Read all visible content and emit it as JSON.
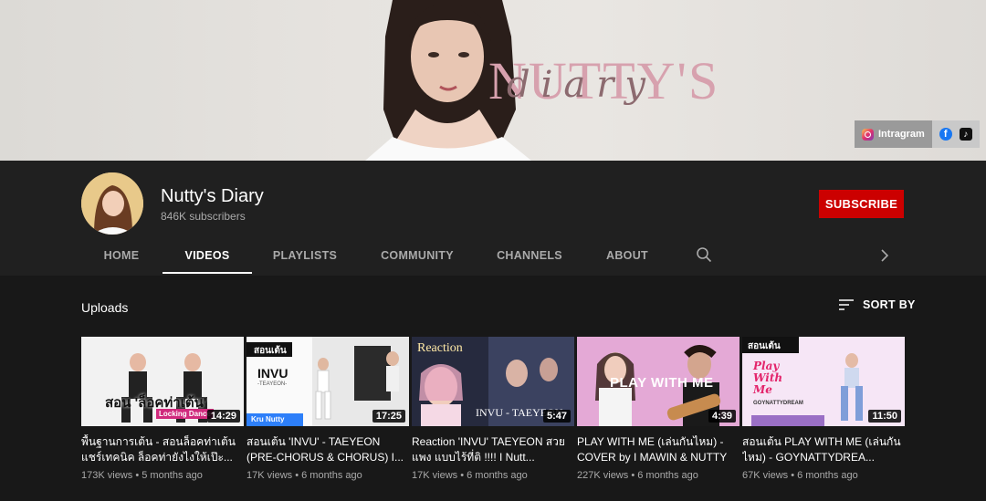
{
  "banner": {
    "logo_main": "NUTTY'S",
    "logo_script": "diary",
    "links": {
      "instagram_label": "Intragram",
      "facebook_glyph": "f",
      "tiktok_glyph": "♪"
    }
  },
  "channel": {
    "name": "Nutty's Diary",
    "subscribers": "846K subscribers",
    "subscribe_label": "SUBSCRIBE"
  },
  "tabs": [
    {
      "label": "HOME"
    },
    {
      "label": "VIDEOS"
    },
    {
      "label": "PLAYLISTS"
    },
    {
      "label": "COMMUNITY"
    },
    {
      "label": "CHANNELS"
    },
    {
      "label": "ABOUT"
    }
  ],
  "uploads": {
    "title": "Uploads",
    "sort_label": "SORT BY"
  },
  "videos": [
    {
      "title": "พื้นฐานการเต้น - สอนล็อคท่าเต้น แชร์เทคนิค ล็อคท่ายังไงให้เป๊ะ...",
      "views": "173K views",
      "age": "5 months ago",
      "duration": "14:29",
      "thumb_text_1": "สอน 'ล็อคท่าเต้น'",
      "thumb_text_2": "Locking Dance"
    },
    {
      "title": "สอนเต้น 'INVU' - TAEYEON (PRE-CHORUS & CHORUS) I...",
      "views": "17K views",
      "age": "6 months ago",
      "duration": "17:25",
      "thumb_text_1": "สอนเต้น",
      "thumb_text_2": "INVU",
      "thumb_text_3": "-TEAYEON-",
      "thumb_text_4": "Kru Nutty"
    },
    {
      "title": "Reaction 'INVU' TAEYEON สวย แพง แบบไร้ที่ติ !!!! I Nutt...",
      "views": "17K views",
      "age": "6 months ago",
      "duration": "5:47",
      "thumb_text_1": "Reaction",
      "thumb_text_2": "INVU - TAEYEON"
    },
    {
      "title": "PLAY WITH ME (เล่นกันไหม) - COVER by I MAWIN & NUTTY",
      "views": "227K views",
      "age": "6 months ago",
      "duration": "4:39",
      "thumb_text_1": "PLAY WITH ME"
    },
    {
      "title": "สอนเต้น PLAY WITH ME (เล่นกันไหม) - GOYNATTYDREA...",
      "views": "67K views",
      "age": "6 months ago",
      "duration": "11:50",
      "thumb_text_1": "สอนเต้น",
      "thumb_text_2": "Play With Me",
      "thumb_text_3": "GOYNATTYDREAM"
    }
  ]
}
